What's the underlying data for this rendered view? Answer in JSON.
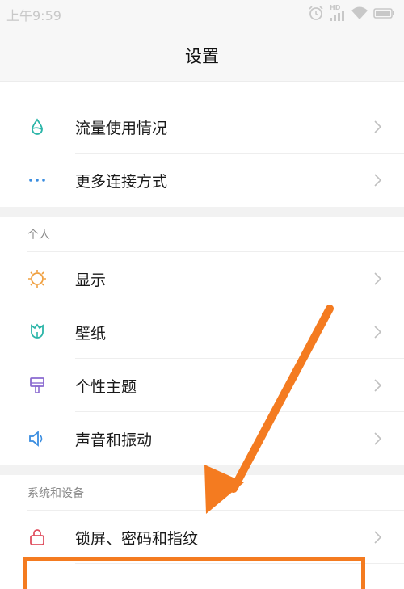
{
  "status_bar": {
    "time": "上午9:59",
    "signal_badge": "HD"
  },
  "header": {
    "title": "设置"
  },
  "rows_top": [
    {
      "label": "流量使用情况",
      "icon": "data-drop-icon"
    },
    {
      "label": "更多连接方式",
      "icon": "more-dots-icon"
    }
  ],
  "sections": [
    {
      "title": "个人",
      "items": [
        {
          "label": "显示",
          "icon": "sun-icon"
        },
        {
          "label": "壁纸",
          "icon": "tulip-icon"
        },
        {
          "label": "个性主题",
          "icon": "brush-icon"
        },
        {
          "label": "声音和振动",
          "icon": "speaker-icon"
        }
      ]
    },
    {
      "title": "系统和设备",
      "items": [
        {
          "label": "锁屏、密码和指纹",
          "icon": "lock-icon"
        }
      ]
    }
  ],
  "colors": {
    "annotation": "#f47b20",
    "icon_teal": "#2bb5a8",
    "icon_orange": "#f0a040",
    "icon_purple": "#8a6ad0",
    "icon_blue": "#3a8de0",
    "icon_red": "#e05060"
  }
}
